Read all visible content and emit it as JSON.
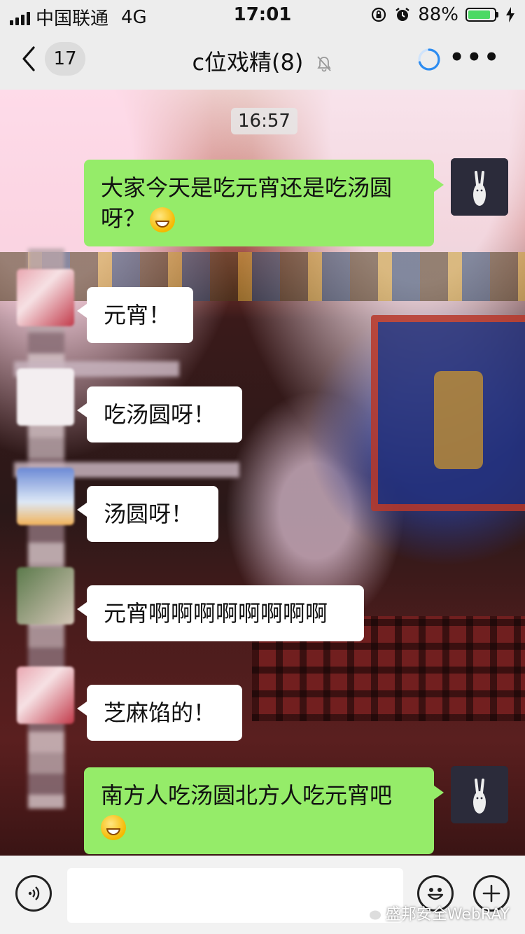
{
  "status_bar": {
    "carrier": "中国联通",
    "network": "4G",
    "time": "17:01",
    "battery_percent": "88%",
    "battery_level": 0.88
  },
  "nav": {
    "back_badge": "17",
    "title": "c位戏精(8)"
  },
  "chat": {
    "timestamp": "16:57",
    "messages": [
      {
        "sender": "me",
        "text": "大家今天是吃元宵还是吃汤圆呀？",
        "emoji": "grinning-emoji"
      },
      {
        "sender": "other",
        "text": "元宵！"
      },
      {
        "sender": "other",
        "text": "吃汤圆呀！"
      },
      {
        "sender": "other",
        "text": "汤圆呀！"
      },
      {
        "sender": "other",
        "text": "元宵啊啊啊啊啊啊啊啊"
      },
      {
        "sender": "other",
        "text": "芝麻馅的！"
      },
      {
        "sender": "me",
        "text": "南方人吃汤圆北方人吃元宵吧",
        "emoji": "squinting-laughing-emoji"
      }
    ]
  },
  "input_bar": {
    "placeholder": ""
  },
  "watermark": "盛邦安全WebRAY",
  "colors": {
    "my_bubble": "#95ec69",
    "other_bubble": "#ffffff",
    "battery": "#4cd964",
    "loading_spinner": "#2d8cf0"
  }
}
